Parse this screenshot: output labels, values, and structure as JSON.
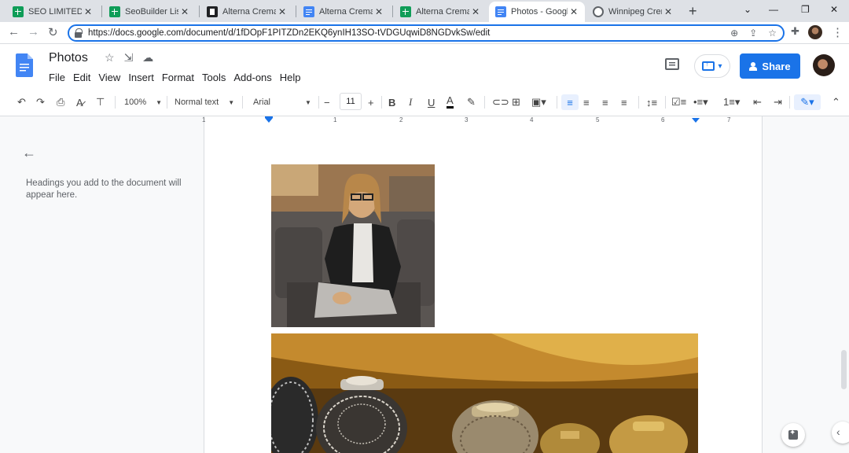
{
  "browser": {
    "tabs": [
      {
        "title": "SEO LIMITED - G",
        "icon": "google-sheets-icon"
      },
      {
        "title": "SeoBuilder List - ",
        "icon": "google-sheets-icon"
      },
      {
        "title": "Alterna Crematio",
        "icon": "site-favicon-icon"
      },
      {
        "title": "Alterna Crematio",
        "icon": "google-docs-icon"
      },
      {
        "title": "Alterna Crematio",
        "icon": "google-sheets-icon"
      },
      {
        "title": "Photos - Google",
        "icon": "google-docs-icon"
      },
      {
        "title": "Winnipeg Crema",
        "icon": "globe-icon"
      }
    ],
    "active_tab": 5,
    "new_tab": "+",
    "url": "https://docs.google.com/document/d/1fDOpF1PITZDn2EKQ6ynIH13SO-tVDGUqwiD8NGDvkSw/edit"
  },
  "docs": {
    "title": "Photos",
    "menu": [
      "File",
      "Edit",
      "View",
      "Insert",
      "Format",
      "Tools",
      "Add-ons",
      "Help"
    ],
    "share_label": "Share",
    "toolbar": {
      "zoom": "100%",
      "style": "Normal text",
      "font": "Arial",
      "font_size": "11",
      "bold": "B",
      "italic": "I",
      "underline": "U",
      "text_color": "A"
    },
    "ruler_numbers": [
      "1",
      "1",
      "2",
      "3",
      "4",
      "5",
      "6",
      "7"
    ],
    "outline_placeholder": "Headings you add to the document will appear here."
  },
  "colors": {
    "accent": "#1a73e8",
    "share_button": "#1a73e8",
    "sheets_green": "#0f9d58",
    "docs_blue": "#4285f4"
  }
}
